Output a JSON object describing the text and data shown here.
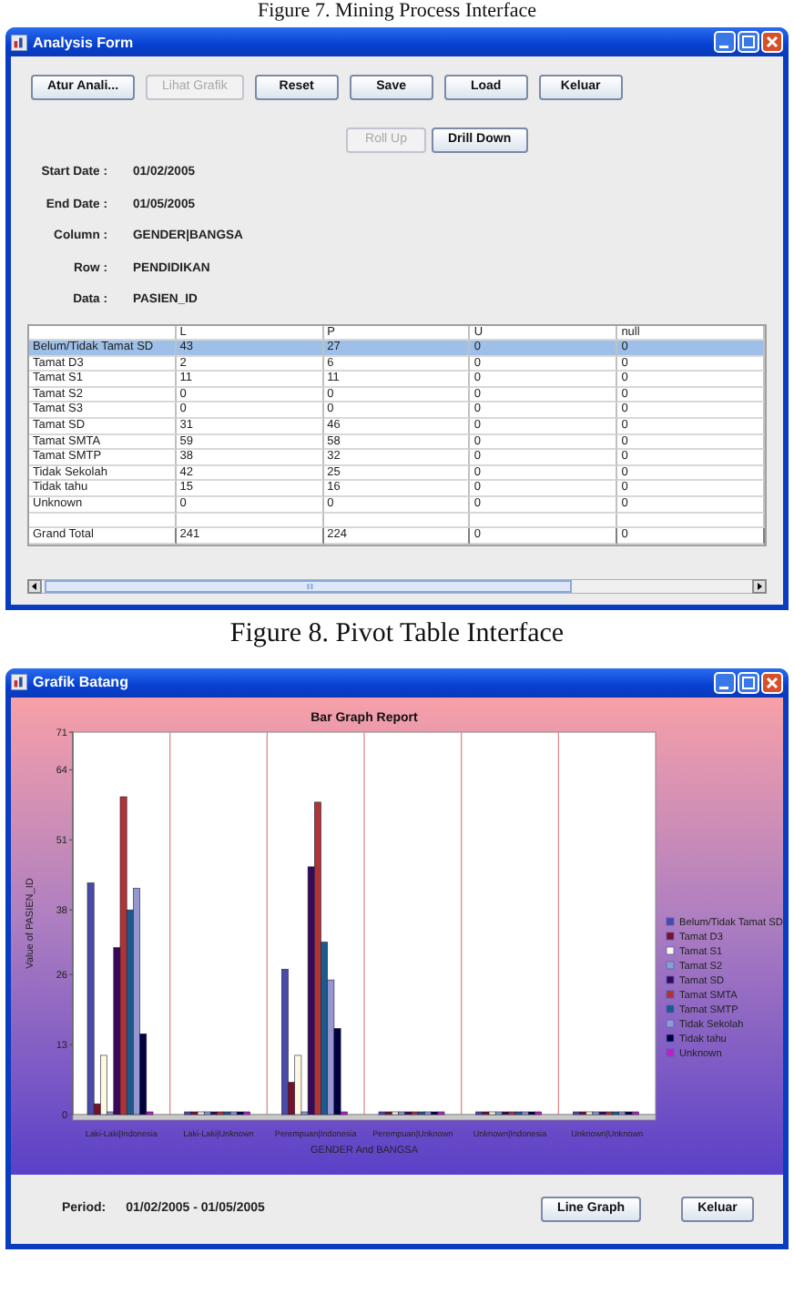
{
  "figure_caption_top": "Figure 7. Mining Process Interface",
  "analysis_window": {
    "title": "Analysis Form",
    "toolbar": [
      {
        "label": "Atur Anali...",
        "disabled": false
      },
      {
        "label": "Lihat Grafik",
        "disabled": true
      },
      {
        "label": "Reset",
        "disabled": false
      },
      {
        "label": "Save",
        "disabled": false
      },
      {
        "label": "Load",
        "disabled": false
      },
      {
        "label": "Keluar",
        "disabled": false
      }
    ],
    "drill_buttons": [
      {
        "label": "Roll Up",
        "disabled": true
      },
      {
        "label": "Drill Down",
        "disabled": false
      }
    ],
    "fields": [
      {
        "label": "Start Date :",
        "value": "01/02/2005"
      },
      {
        "label": "End Date :",
        "value": "01/05/2005"
      },
      {
        "label": "Column :",
        "value": "GENDER|BANGSA"
      },
      {
        "label": "Row :",
        "value": "PENDIDIKAN"
      },
      {
        "label": "Data :",
        "value": "PASIEN_ID"
      }
    ],
    "table": {
      "columns": [
        "",
        "L",
        "P",
        "U",
        "null"
      ],
      "rows": [
        {
          "kind": "data",
          "selected": true,
          "cells": [
            "Belum/Tidak Tamat SD",
            "43",
            "27",
            "0",
            "0"
          ]
        },
        {
          "kind": "data",
          "selected": false,
          "cells": [
            "Tamat D3",
            "2",
            "6",
            "0",
            "0"
          ]
        },
        {
          "kind": "data",
          "selected": false,
          "cells": [
            "Tamat S1",
            "11",
            "11",
            "0",
            "0"
          ]
        },
        {
          "kind": "data",
          "selected": false,
          "cells": [
            "Tamat S2",
            "0",
            "0",
            "0",
            "0"
          ]
        },
        {
          "kind": "data",
          "selected": false,
          "cells": [
            "Tamat S3",
            "0",
            "0",
            "0",
            "0"
          ]
        },
        {
          "kind": "data",
          "selected": false,
          "cells": [
            "Tamat SD",
            "31",
            "46",
            "0",
            "0"
          ]
        },
        {
          "kind": "data",
          "selected": false,
          "cells": [
            "Tamat SMTA",
            "59",
            "58",
            "0",
            "0"
          ]
        },
        {
          "kind": "data",
          "selected": false,
          "cells": [
            "Tamat SMTP",
            "38",
            "32",
            "0",
            "0"
          ]
        },
        {
          "kind": "data",
          "selected": false,
          "cells": [
            "Tidak Sekolah",
            "42",
            "25",
            "0",
            "0"
          ]
        },
        {
          "kind": "data",
          "selected": false,
          "cells": [
            "Tidak tahu",
            "15",
            "16",
            "0",
            "0"
          ]
        },
        {
          "kind": "data",
          "selected": false,
          "cells": [
            "Unknown",
            "0",
            "0",
            "0",
            "0"
          ]
        },
        {
          "kind": "total",
          "selected": false,
          "cells": [
            "Grand Total",
            "241",
            "224",
            "0",
            "0"
          ]
        }
      ]
    }
  },
  "figure_caption_middle": "Figure 8. Pivot Table Interface",
  "graph_window": {
    "title": "Grafik Batang",
    "chart_data": {
      "type": "bar",
      "title": "Bar Graph Report",
      "xlabel": "GENDER And BANGSA",
      "ylabel": "Value of PASIEN_ID",
      "categories": [
        "Laki-Laki|Indonesia",
        "Laki-Laki|Unknown",
        "Perempuan|Indonesia",
        "Perempuan|Unknown",
        "Unknown|Indonesia",
        "Unknown|Unknown"
      ],
      "ylim": [
        0,
        71
      ],
      "legend": "right",
      "yticks": [
        0,
        13,
        26,
        38,
        51,
        64,
        71
      ],
      "series": [
        {
          "name": "Belum/Tidak Tamat SD",
          "color": "#4a4aa8",
          "values": [
            43,
            0,
            27,
            0,
            0,
            0
          ]
        },
        {
          "name": "Tamat D3",
          "color": "#7a1028",
          "values": [
            2,
            0,
            6,
            0,
            0,
            0
          ]
        },
        {
          "name": "Tamat S1",
          "color": "#fff8e0",
          "values": [
            11,
            0,
            11,
            0,
            0,
            0
          ]
        },
        {
          "name": "Tamat S2",
          "color": "#8aa0c8",
          "values": [
            0,
            0,
            0,
            0,
            0,
            0
          ]
        },
        {
          "name": "Tamat SD",
          "color": "#3a0858",
          "values": [
            31,
            0,
            46,
            0,
            0,
            0
          ]
        },
        {
          "name": "Tamat SMTA",
          "color": "#b03434",
          "values": [
            59,
            0,
            58,
            0,
            0,
            0
          ]
        },
        {
          "name": "Tamat SMTP",
          "color": "#1c5a8c",
          "values": [
            38,
            0,
            32,
            0,
            0,
            0
          ]
        },
        {
          "name": "Tidak Sekolah",
          "color": "#9696d0",
          "values": [
            42,
            0,
            25,
            0,
            0,
            0
          ]
        },
        {
          "name": "Tidak tahu",
          "color": "#000040",
          "values": [
            15,
            0,
            16,
            0,
            0,
            0
          ]
        },
        {
          "name": "Unknown",
          "color": "#c020c0",
          "values": [
            0,
            0,
            0,
            0,
            0,
            0
          ]
        }
      ]
    },
    "period_label": "Period:",
    "period": "01/02/2005 - 01/05/2005",
    "buttons": [
      "Line Graph",
      "Keluar"
    ]
  }
}
